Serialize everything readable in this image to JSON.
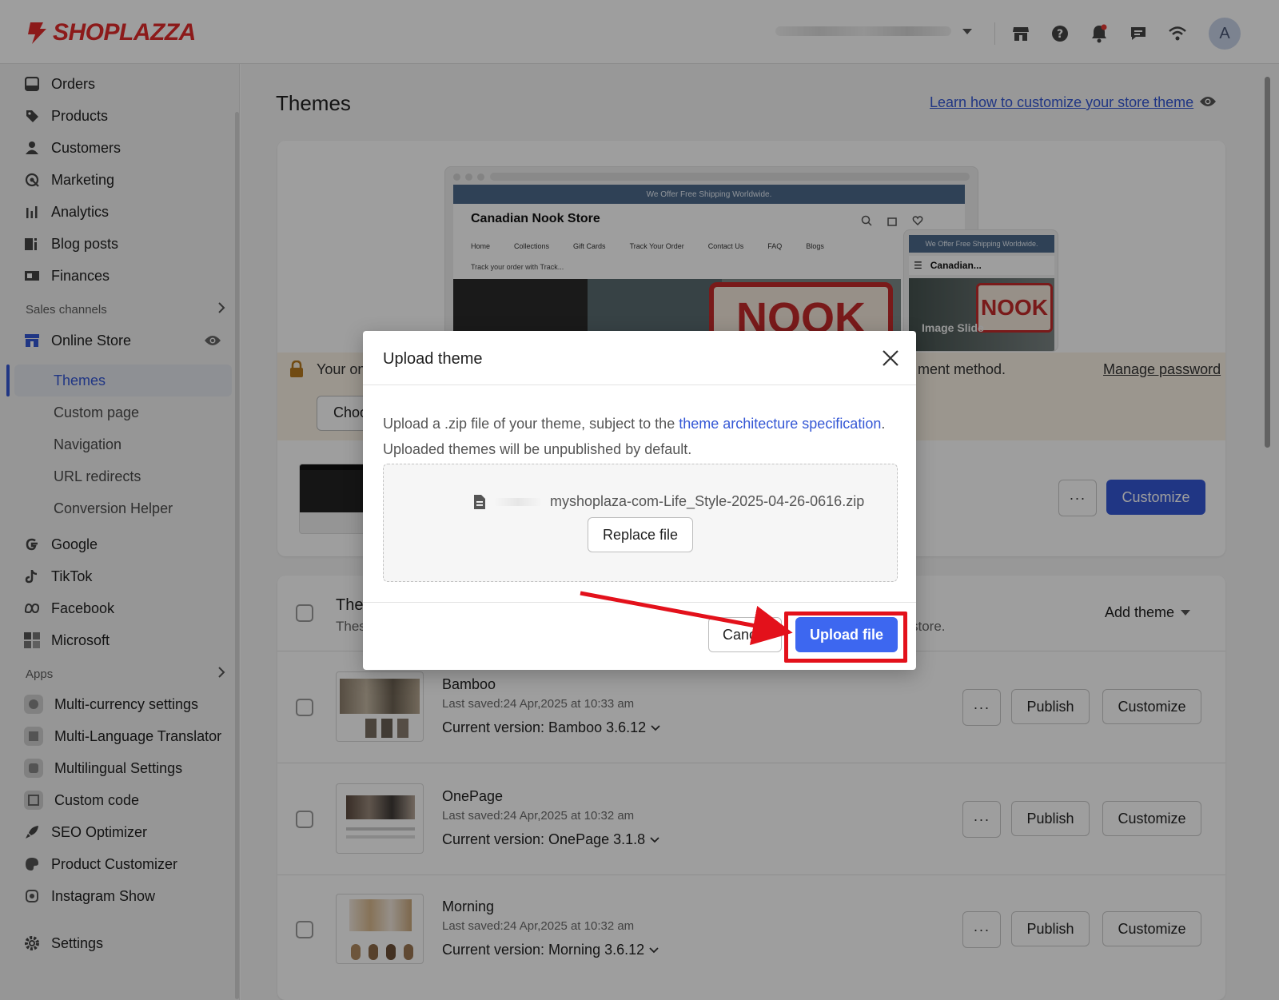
{
  "brand": {
    "name": "SHOPLAZZA",
    "color": "#e32b2b"
  },
  "topbar": {
    "icons": [
      "store-icon",
      "help-icon",
      "bell-icon",
      "chat-icon",
      "wifi-icon"
    ],
    "avatar_letter": "A"
  },
  "sidebar": {
    "items": [
      {
        "label": "Orders",
        "icon": "orders-icon"
      },
      {
        "label": "Products",
        "icon": "tag-icon"
      },
      {
        "label": "Customers",
        "icon": "person-icon"
      },
      {
        "label": "Marketing",
        "icon": "marketing-icon"
      },
      {
        "label": "Analytics",
        "icon": "bar-chart-icon"
      },
      {
        "label": "Blog posts",
        "icon": "blog-icon"
      },
      {
        "label": "Finances",
        "icon": "finance-icon"
      }
    ],
    "sales_channels_label": "Sales channels",
    "online_store_label": "Online Store",
    "online_store_subitems": [
      "Themes",
      "Custom page",
      "Navigation",
      "URL redirects",
      "Conversion Helper"
    ],
    "channels": [
      {
        "label": "Google",
        "icon": "google-icon"
      },
      {
        "label": "TikTok",
        "icon": "tiktok-icon"
      },
      {
        "label": "Facebook",
        "icon": "meta-icon"
      },
      {
        "label": "Microsoft",
        "icon": "microsoft-icon"
      }
    ],
    "apps_label": "Apps",
    "apps": [
      {
        "label": "Multi-currency settings",
        "icon": "currency-app-icon"
      },
      {
        "label": "Multi-Language Translator",
        "icon": "translator-app-icon"
      },
      {
        "label": "Multilingual Settings",
        "icon": "multilingual-app-icon"
      },
      {
        "label": "Custom code",
        "icon": "code-app-icon"
      },
      {
        "label": "SEO Optimizer",
        "icon": "rocket-icon"
      },
      {
        "label": "Product Customizer",
        "icon": "palette-icon"
      },
      {
        "label": "Instagram Show",
        "icon": "instagram-icon"
      }
    ],
    "settings_label": "Settings"
  },
  "page": {
    "title": "Themes",
    "learn_link": "Learn how to customize your store theme"
  },
  "preview": {
    "banner_text": "We Offer Free Shipping Worldwide.",
    "store_name": "Canadian Nook Store",
    "nav": [
      "Home",
      "Collections",
      "Gift Cards",
      "Track Your Order",
      "Contact Us",
      "FAQ",
      "Blogs"
    ],
    "track_text": "Track your order with Track...",
    "mobile_banner": "We Offer Free Shipping Worldwide.",
    "mobile_store": "Canadian...",
    "mobile_caption": "Image Slide",
    "sign_text": "NOOK",
    "mobile_sign_text": "NOOK"
  },
  "notice": {
    "text_start": "Your on",
    "text_end": "ment method.",
    "manage_password": "Manage password",
    "choose_button": "Choo"
  },
  "current_theme": {
    "more_label": "···",
    "customize_label": "Customize"
  },
  "library": {
    "title": "The",
    "desc_start": "Thes",
    "desc_end": "store.",
    "add_theme_label": "Add theme",
    "themes": [
      {
        "name": "Bamboo",
        "saved": "Last saved:24 Apr,2025 at 10:33 am",
        "version": "Current version: Bamboo 3.6.12",
        "more": "···",
        "publish": "Publish",
        "customize": "Customize"
      },
      {
        "name": "OnePage",
        "saved": "Last saved:24 Apr,2025 at 10:32 am",
        "version": "Current version: OnePage 3.1.8",
        "more": "···",
        "publish": "Publish",
        "customize": "Customize"
      },
      {
        "name": "Morning",
        "saved": "Last saved:24 Apr,2025 at 10:32 am",
        "version": "Current version: Morning 3.6.12",
        "more": "···",
        "publish": "Publish",
        "customize": "Customize"
      }
    ]
  },
  "modal": {
    "title": "Upload theme",
    "text_before_link": "Upload a .zip file of your theme, subject to the ",
    "link_text": "theme architecture specification",
    "text_after_link": ".",
    "line2": "Uploaded themes will be unpublished by default.",
    "file_name": "myshoplaza-com-Life_Style-2025-04-26-0616.zip",
    "replace_label": "Replace file",
    "cancel_label": "Cancel",
    "upload_label": "Upload file",
    "highlight_color": "#e3111b",
    "accent_color": "#3d67f0"
  }
}
